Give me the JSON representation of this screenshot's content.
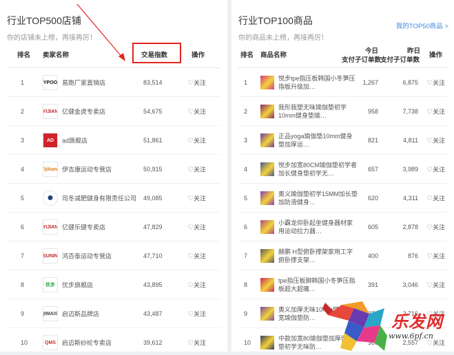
{
  "shops": {
    "title": "行业TOP500店铺",
    "subtitle": "你的店铺未上榜，再接再厉！",
    "headers": {
      "rank": "排名",
      "name": "卖家名称",
      "index": "交易指数",
      "action": "操作"
    },
    "follow_label": "关注",
    "rows": [
      {
        "rank": "1",
        "name": "易跑厂家直销店",
        "value": "83,514",
        "logo": "YPOO",
        "logo_color": "#111111"
      },
      {
        "rank": "2",
        "name": "亿健金虎专卖店",
        "value": "54,675",
        "logo": "YIJIAN",
        "logo_color": "#c0282d"
      },
      {
        "rank": "3",
        "name": "ad旗舰店",
        "value": "51,861",
        "logo": "AD",
        "logo_color": "#ffffff"
      },
      {
        "rank": "4",
        "name": "伊吉康运动专营店",
        "value": "50,915",
        "logo": "Yijikang",
        "logo_color": "#e07b1a"
      },
      {
        "rank": "5",
        "name": "司冬减肥健身有限责任公司",
        "value": "49,085",
        "logo": "●",
        "logo_color": "#1f3f7a"
      },
      {
        "rank": "6",
        "name": "亿健乐健专卖店",
        "value": "47,829",
        "logo": "YIJIAN",
        "logo_color": "#c0282d"
      },
      {
        "rank": "7",
        "name": "鸿百泰运动专营店",
        "value": "47,710",
        "logo": "SUNIN",
        "logo_color": "#c0282d"
      },
      {
        "rank": "8",
        "name": "优步旗舰店",
        "value": "43,895",
        "logo": "优步",
        "logo_color": "#2aa63a"
      },
      {
        "rank": "9",
        "name": "启迈斯品牌店",
        "value": "43,487",
        "logo": "QIMAISI",
        "logo_color": "#444444"
      },
      {
        "rank": "10",
        "name": "启迈斯纱纶专卖店",
        "value": "39,612",
        "logo": "QMS",
        "logo_color": "#d0302a"
      }
    ]
  },
  "products": {
    "title": "行业TOP100商品",
    "subtitle": "你的商品未上榜，再接再厉！",
    "link": "我的TOP50商品 >",
    "headers": {
      "rank": "排名",
      "name": "商品名称",
      "today_a": "今日",
      "today_b": "支付子订单数",
      "yest_a": "昨日",
      "yest_b": "支付子订单数",
      "action": "操作"
    },
    "follow_label": "关注",
    "rows": [
      {
        "rank": "1",
        "name": "悦步tpe指压板韩国小冬笋压指板升级加…",
        "today": "1,267",
        "yesterday": "6,875",
        "thumb": "#d93a7a"
      },
      {
        "rank": "2",
        "name": "我形我塑无味瑜伽垫初学10mm健身垫瑜…",
        "today": "958",
        "yesterday": "7,738",
        "thumb": "#8a2a6a"
      },
      {
        "rank": "3",
        "name": "正品yoga瑜伽垫10mm健身垫加厚运…",
        "today": "821",
        "yesterday": "4,811",
        "thumb": "#6a3a9a"
      },
      {
        "rank": "4",
        "name": "悦步加宽80CM瑜伽垫初学者加长健身垫初学无…",
        "today": "657",
        "yesterday": "3,989",
        "thumb": "#4a5a8a"
      },
      {
        "rank": "5",
        "name": "奥义瑜伽垫初学15MM加长垫加防滑健身…",
        "today": "620",
        "yesterday": "4,311",
        "thumb": "#8a3ab0"
      },
      {
        "rank": "6",
        "name": "小霸龙仰卧起坐健身器材家用运动拉力器…",
        "today": "605",
        "yesterday": "2,878",
        "thumb": "#b04a7a"
      },
      {
        "rank": "7",
        "name": "赫鹏 H型俯卧撑架家用工字俯卧撑支架…",
        "today": "400",
        "yesterday": "876",
        "thumb": "#5a5a5a"
      },
      {
        "rank": "8",
        "name": "tpe指压板脚韩国小冬笋压指板超大超痛…",
        "today": "391",
        "yesterday": "3,046",
        "thumb": "#c82a5a"
      },
      {
        "rank": "9",
        "name": "奥义加厚无味10mm健身垫加宽瑜伽垫防…",
        "today": "378",
        "yesterday": "2,716",
        "thumb": "#7a4aa0"
      },
      {
        "rank": "10",
        "name": "中款加宽80瑜伽垫加厚健身垫初学无味防…",
        "today": "368",
        "yesterday": "2,557",
        "thumb": "#3a3a5a"
      }
    ]
  },
  "watermark": {
    "text": "乐发网",
    "url": "www.6pf.cn"
  },
  "colors": {
    "highlight": "#e1241f",
    "link": "#3d8ae0"
  }
}
